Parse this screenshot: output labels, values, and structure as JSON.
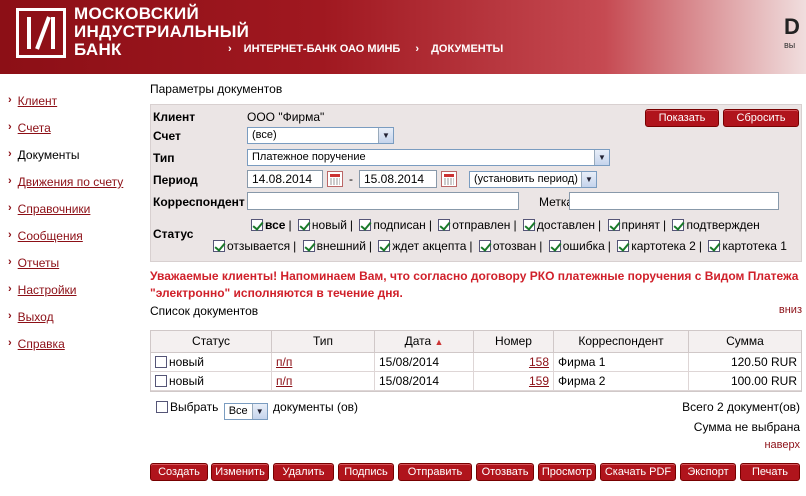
{
  "header": {
    "bank_name_line1": "МОСКОВСКИЙ",
    "bank_name_line2": "ИНДУСТРИАЛЬНЫЙ",
    "bank_name_line3": "БАНК",
    "crumb1": "ИНТЕРНЕТ-БАНК ОАО МИНБ",
    "crumb2": "ДОКУМЕНТЫ",
    "crumb_bullet": "›",
    "exit_letter": "D",
    "exit_text": "вы"
  },
  "sidebar": {
    "items": [
      {
        "label": "Клиент",
        "active": false
      },
      {
        "label": "Счета",
        "active": false
      },
      {
        "label": "Документы",
        "active": true
      },
      {
        "label": "Движения по счету",
        "active": false
      },
      {
        "label": "Справочники",
        "active": false
      },
      {
        "label": "Сообщения",
        "active": false
      },
      {
        "label": "Отчеты",
        "active": false
      },
      {
        "label": "Настройки",
        "active": false
      },
      {
        "label": "Выход",
        "active": false
      },
      {
        "label": "Справка",
        "active": false
      }
    ],
    "bullet": "›"
  },
  "params": {
    "title": "Параметры документов",
    "client_label": "Клиент",
    "client_value": "ООО \"Фирма\"",
    "account_label": "Счет",
    "account_value": "(все)",
    "type_label": "Тип",
    "type_value": "Платежное поручение",
    "period_label": "Период",
    "date_from": "14.08.2014",
    "date_dash": "-",
    "date_to": "15.08.2014",
    "period_preset": "(установить период)",
    "correspondent_label": "Корреспондент",
    "correspondent_value": "",
    "mark_label": "Метка:",
    "mark_value": "",
    "status_label": "Статус",
    "show_button": "Показать",
    "reset_button": "Сбросить",
    "statuses_row1": [
      {
        "label": "все",
        "checked": true,
        "bold": true
      },
      {
        "label": "новый",
        "checked": true
      },
      {
        "label": "подписан",
        "checked": true
      },
      {
        "label": "отправлен",
        "checked": true
      },
      {
        "label": "доставлен",
        "checked": true
      },
      {
        "label": "принят",
        "checked": true
      },
      {
        "label": "подтвержден",
        "checked": true
      }
    ],
    "statuses_row2": [
      {
        "label": "отзывается",
        "checked": true
      },
      {
        "label": "внешний",
        "checked": true
      },
      {
        "label": "ждет акцепта",
        "checked": true
      },
      {
        "label": "отозван",
        "checked": true
      },
      {
        "label": "ошибка",
        "checked": true
      },
      {
        "label": "картотека 2",
        "checked": true
      },
      {
        "label": "картотека 1",
        "checked": true
      }
    ]
  },
  "notice": {
    "line1": "Уважаемые клиенты! Напоминаем Вам, что согласно договору РКО платежные поручения с Видом Платежа",
    "line2": "\"электронно\" исполняются в течение дня."
  },
  "list": {
    "title": "Список документов",
    "down_link": "вниз",
    "columns": [
      "Статус",
      "Тип",
      "Дата",
      "Номер",
      "Корреспондент",
      "Сумма"
    ],
    "sort_indicator": "▲",
    "rows": [
      {
        "status": "новый",
        "type": "п/п",
        "date": "15/08/2014",
        "number": "158",
        "correspondent": "Фирма 1",
        "amount": "120.50 RUR"
      },
      {
        "status": "новый",
        "type": "п/п",
        "date": "15/08/2014",
        "number": "159",
        "correspondent": "Фирма 2",
        "amount": "100.00 RUR"
      }
    ],
    "select_label": "Выбрать",
    "select_value": "Все",
    "select_suffix": "документы (ов)",
    "total": "Всего 2 документ(ов)",
    "sum": "Сумма не выбрана",
    "up_link": "наверх"
  },
  "actions": [
    "Создать",
    "Изменить",
    "Удалить",
    "Подпись",
    "Отправить",
    "Отозвать",
    "Просмотр",
    "Скачать PDF",
    "Экспорт",
    "Печать"
  ],
  "colors": {
    "brand": "#8c0f16",
    "button": "#b0141c",
    "notice": "#d0202a",
    "panel": "#ebe5e5"
  }
}
